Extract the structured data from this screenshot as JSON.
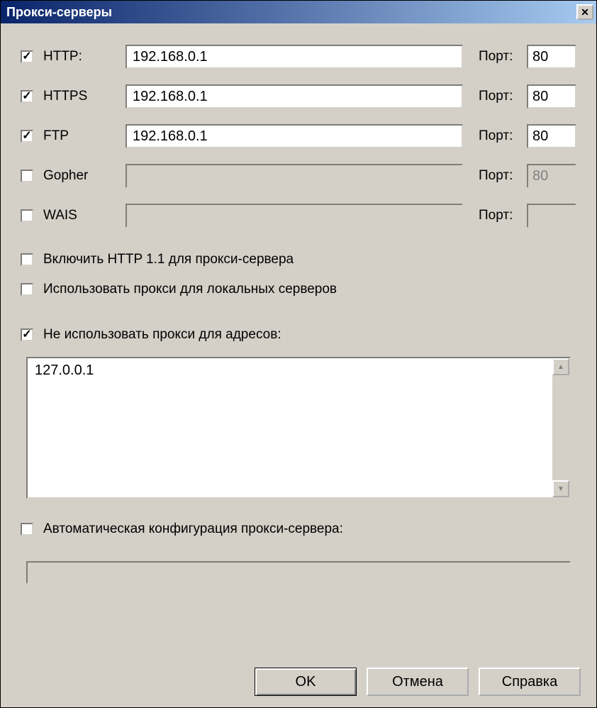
{
  "title": "Прокси-серверы",
  "portLabel": "Порт:",
  "protocols": [
    {
      "name": "HTTP:",
      "checked": true,
      "address": "192.168.0.1",
      "port": "80",
      "enabled": true
    },
    {
      "name": "HTTPS",
      "checked": true,
      "address": "192.168.0.1",
      "port": "80",
      "enabled": true
    },
    {
      "name": "FTP",
      "checked": true,
      "address": "192.168.0.1",
      "port": "80",
      "enabled": true
    },
    {
      "name": "Gopher",
      "checked": false,
      "address": "",
      "port": "80",
      "enabled": false
    },
    {
      "name": "WAIS",
      "checked": false,
      "address": "",
      "port": "",
      "enabled": false
    }
  ],
  "options": {
    "http11": {
      "label": "Включить HTTP 1.1 для прокси-сервера",
      "checked": false
    },
    "useLocal": {
      "label": "Использовать прокси для локальных серверов",
      "checked": false
    },
    "noProxy": {
      "label": "Не использовать прокси для адресов:",
      "checked": true
    },
    "noProxyList": "127.0.0.1",
    "autoConfig": {
      "label": "Автоматическая конфигурация прокси-сервера:",
      "checked": false
    },
    "autoConfigUrl": ""
  },
  "buttons": {
    "ok": "OK",
    "cancel": "Отмена",
    "help": "Справка"
  }
}
